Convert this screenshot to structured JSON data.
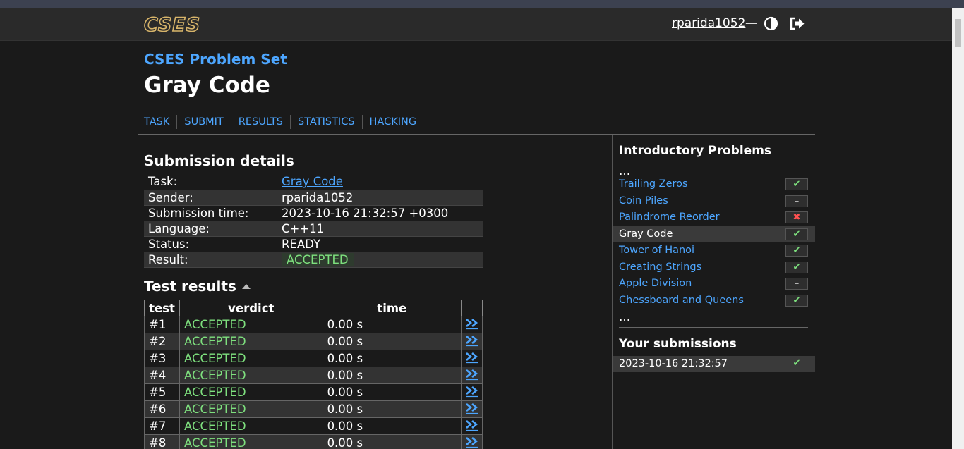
{
  "header": {
    "logo": "CSES",
    "username": "rparida1052",
    "separator": "—"
  },
  "page": {
    "problem_set": "CSES Problem Set",
    "title": "Gray Code"
  },
  "tabs": [
    "TASK",
    "SUBMIT",
    "RESULTS",
    "STATISTICS",
    "HACKING"
  ],
  "details": {
    "heading": "Submission details",
    "rows": [
      {
        "key": "Task:",
        "value": "Gray Code"
      },
      {
        "key": "Sender:",
        "value": "rparida1052"
      },
      {
        "key": "Submission time:",
        "value": "2023-10-16 21:32:57 +0300"
      },
      {
        "key": "Language:",
        "value": "C++11"
      },
      {
        "key": "Status:",
        "value": "READY"
      },
      {
        "key": "Result:",
        "value": "ACCEPTED"
      }
    ]
  },
  "tests": {
    "heading": "Test results",
    "columns": [
      "test",
      "verdict",
      "time"
    ],
    "rows": [
      {
        "test": "#1",
        "verdict": "ACCEPTED",
        "time": "0.00 s"
      },
      {
        "test": "#2",
        "verdict": "ACCEPTED",
        "time": "0.00 s"
      },
      {
        "test": "#3",
        "verdict": "ACCEPTED",
        "time": "0.00 s"
      },
      {
        "test": "#4",
        "verdict": "ACCEPTED",
        "time": "0.00 s"
      },
      {
        "test": "#5",
        "verdict": "ACCEPTED",
        "time": "0.00 s"
      },
      {
        "test": "#6",
        "verdict": "ACCEPTED",
        "time": "0.00 s"
      },
      {
        "test": "#7",
        "verdict": "ACCEPTED",
        "time": "0.00 s"
      },
      {
        "test": "#8",
        "verdict": "ACCEPTED",
        "time": "0.00 s"
      }
    ],
    "view_icon": "double-chevron-right-icon"
  },
  "sidebar": {
    "heading": "Introductory Problems",
    "ellipsis": "...",
    "problems": [
      {
        "name": "Trailing Zeros",
        "status": "ok",
        "mark": "✔"
      },
      {
        "name": "Coin Piles",
        "status": "none",
        "mark": "–"
      },
      {
        "name": "Palindrome Reorder",
        "status": "bad",
        "mark": "✖"
      },
      {
        "name": "Gray Code",
        "status": "ok",
        "mark": "✔",
        "current": true
      },
      {
        "name": "Tower of Hanoi",
        "status": "ok",
        "mark": "✔"
      },
      {
        "name": "Creating Strings",
        "status": "ok",
        "mark": "✔"
      },
      {
        "name": "Apple Division",
        "status": "none",
        "mark": "–"
      },
      {
        "name": "Chessboard and Queens",
        "status": "ok",
        "mark": "✔"
      }
    ],
    "submissions_heading": "Your submissions",
    "submissions": [
      {
        "time": "2023-10-16 21:32:57",
        "status": "ok",
        "mark": "✔"
      }
    ]
  },
  "colors": {
    "link": "#4da6ff",
    "accepted": "#7ee07e",
    "rejected": "#ff5050",
    "logo": "#d7b46a",
    "background": "#1a1a1a"
  }
}
